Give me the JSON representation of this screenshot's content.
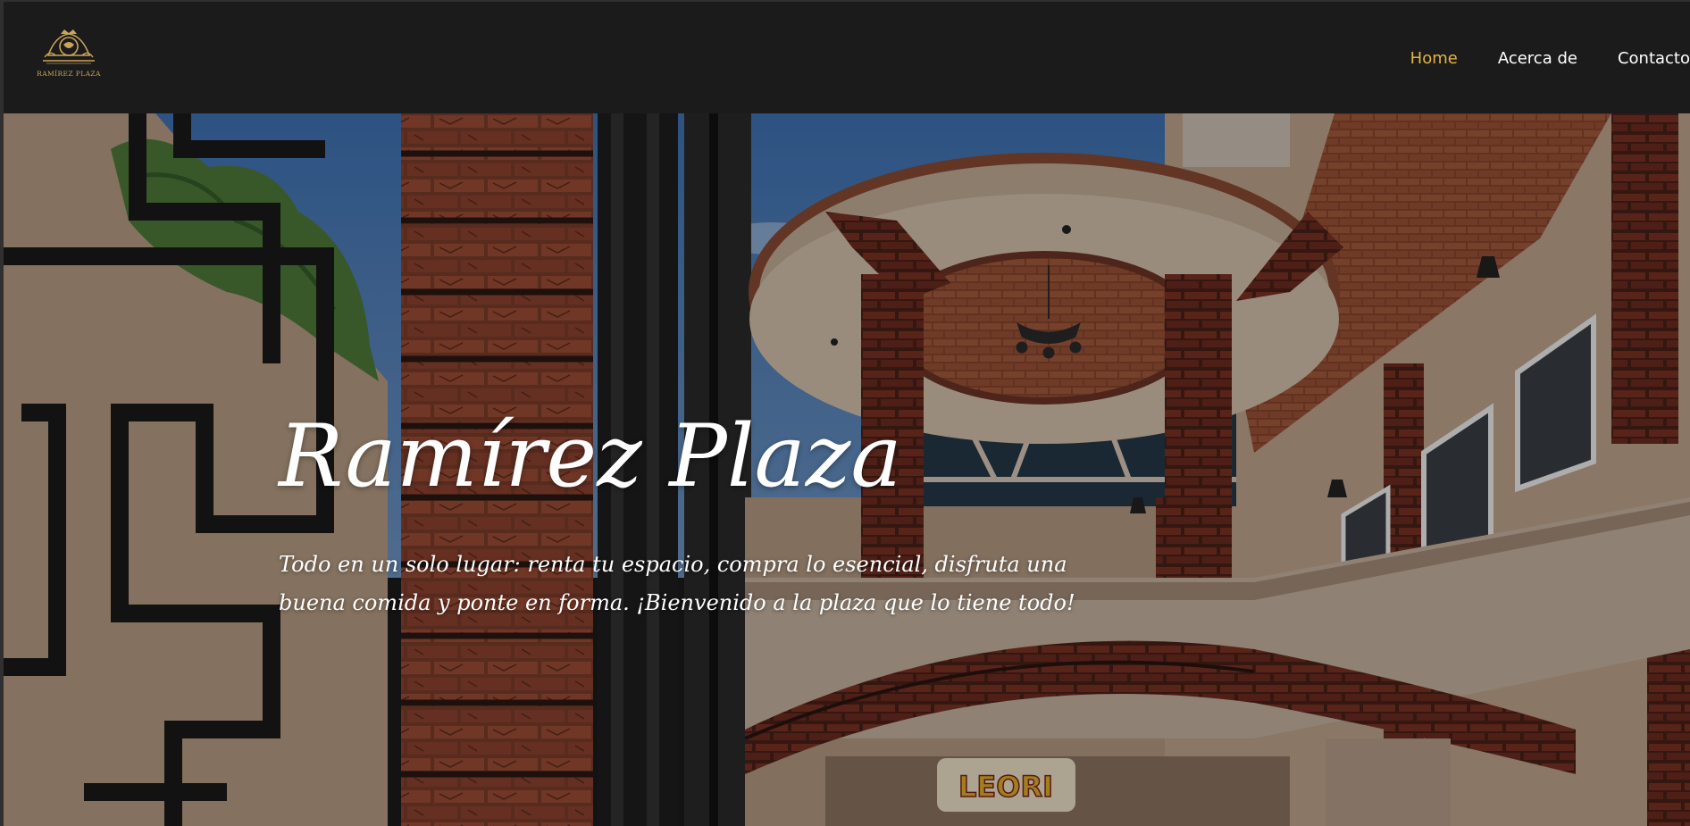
{
  "brand": {
    "logo_text": "RAMÍREZ PLAZA",
    "logo_icon": "crest-icon",
    "accent_color": "#e3b43e"
  },
  "nav": {
    "items": [
      {
        "label": "Home",
        "active": true
      },
      {
        "label": "Acerca de",
        "active": false
      },
      {
        "label": "Contacto",
        "active": false
      }
    ]
  },
  "hero": {
    "title": "Ramírez Plaza",
    "subtitle": "Todo en un solo lugar: renta tu espacio, compra lo esencial, disfruta una buena comida y ponte en forma. ¡Bienvenido a la plaza que lo tiene todo!",
    "sign_text": "LEORI"
  }
}
